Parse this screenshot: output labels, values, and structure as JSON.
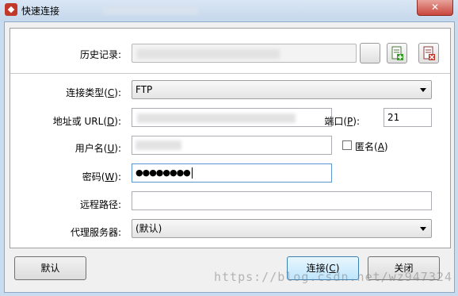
{
  "window": {
    "title": "快速连接",
    "close_label": "✕"
  },
  "history": {
    "label": "历史记录:"
  },
  "form": {
    "conn_type_label": "连接类型(",
    "conn_type_key": "C",
    "conn_type_label_end": "):",
    "conn_type_value": "FTP",
    "address_label": "地址或 URL(",
    "address_key": "D",
    "address_label_end": "):",
    "port_label": "端口(",
    "port_key": "P",
    "port_label_end": "):",
    "port_value": "21",
    "username_label": "用户名(",
    "username_key": "U",
    "username_label_end": "):",
    "anonymous_label": "匿名(",
    "anonymous_key": "A",
    "anonymous_label_end": ")",
    "password_label": "密码(",
    "password_key": "W",
    "password_label_end": "):",
    "password_value": "●●●●●●●●",
    "remote_path_label": "远程路径:",
    "remote_path_value": "",
    "proxy_label": "代理服务器:",
    "proxy_value": "(默认)"
  },
  "buttons": {
    "default": "默认",
    "connect": "连接(",
    "connect_key": "C",
    "connect_end": ")",
    "close": "关闭"
  },
  "watermark": "https://blog.csdn.net/wz947324"
}
